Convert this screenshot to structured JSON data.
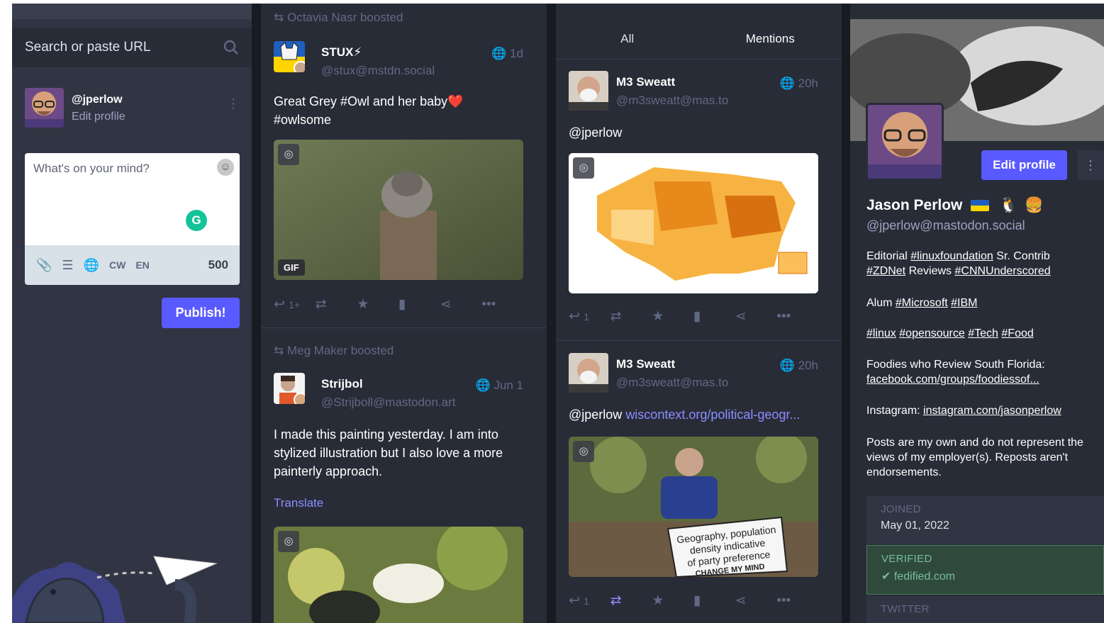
{
  "column_home": {
    "search": {
      "placeholder": "Search or paste URL"
    },
    "account": {
      "handle": "@jperlow",
      "edit_label": "Edit profile"
    },
    "composer": {
      "placeholder": "What's on your mind?",
      "cw_label": "CW",
      "lang_label": "EN",
      "char_count": "500",
      "publish_label": "Publish!"
    }
  },
  "column_timeline": {
    "header_boost": "Octavia Nasr boosted",
    "post1": {
      "name": "STUX⚡",
      "handle": "@stux@mstdn.social",
      "time": "1d",
      "text_line1": "Great Grey #Owl and her baby❤️",
      "text_line2": "#owlsome",
      "media_badge": "GIF",
      "reply_count": "1+"
    },
    "boost2": "Meg Maker boosted",
    "post2": {
      "name": "Strijbol",
      "handle": "@Strijboll@mastodon.art",
      "time": "Jun 1",
      "text_line1": "I made this painting yesterday. I am into",
      "text_line2": "stylized illustration but I also love a more",
      "text_line3": "painterly approach.",
      "translate": "Translate"
    }
  },
  "column_notifications": {
    "tabs": [
      "All",
      "Mentions"
    ],
    "post1": {
      "name": "M3 Sweatt",
      "handle": "@m3sweatt@mas.to",
      "time": "20h",
      "text": "@jperlow",
      "reply_count": "1"
    },
    "post2": {
      "name": "M3 Sweatt",
      "handle": "@m3sweatt@mas.to",
      "time": "20h",
      "mention": "@jperlow",
      "link": "wiscontext.org/political-geogr...",
      "sign_line1": "Geography, population",
      "sign_line2": "density indicative",
      "sign_line3": "of party preference",
      "sign_line4": "CHANGE MY MIND",
      "reply_count": "1"
    }
  },
  "column_profile": {
    "edit_label": "Edit profile",
    "name": "Jason Perlow",
    "handle": "@jperlow@mastodon.social",
    "bio": {
      "l1a": "Editorial ",
      "l1b": "#linuxfoundation",
      "l1c": " Sr. Contrib",
      "l2a": "#ZDNet",
      "l2b": " Reviews ",
      "l2c": "#CNNUnderscored",
      "l3a": "Alum ",
      "l3b": "#Microsoft",
      "l3c": " ",
      "l3d": "#IBM",
      "l4a": "#linux",
      "l4b": "#opensource",
      "l4c": "#Tech",
      "l4d": "#Food",
      "l5a": "Foodies who Review South Florida:",
      "l5b": "facebook.com/groups/foodiessof...",
      "l6a": "Instagram: ",
      "l6b": "instagram.com/jasonperlow",
      "l7a": "Posts are my own and do not represent the",
      "l7b": "views of my employer(s). Reposts aren't",
      "l7c": "endorsements."
    },
    "joined": {
      "key": "JOINED",
      "value": "May 01, 2022"
    },
    "verified": {
      "key": "VERIFIED",
      "value": "✔ fedified.com"
    },
    "twitter": {
      "key": "TWITTER"
    }
  }
}
